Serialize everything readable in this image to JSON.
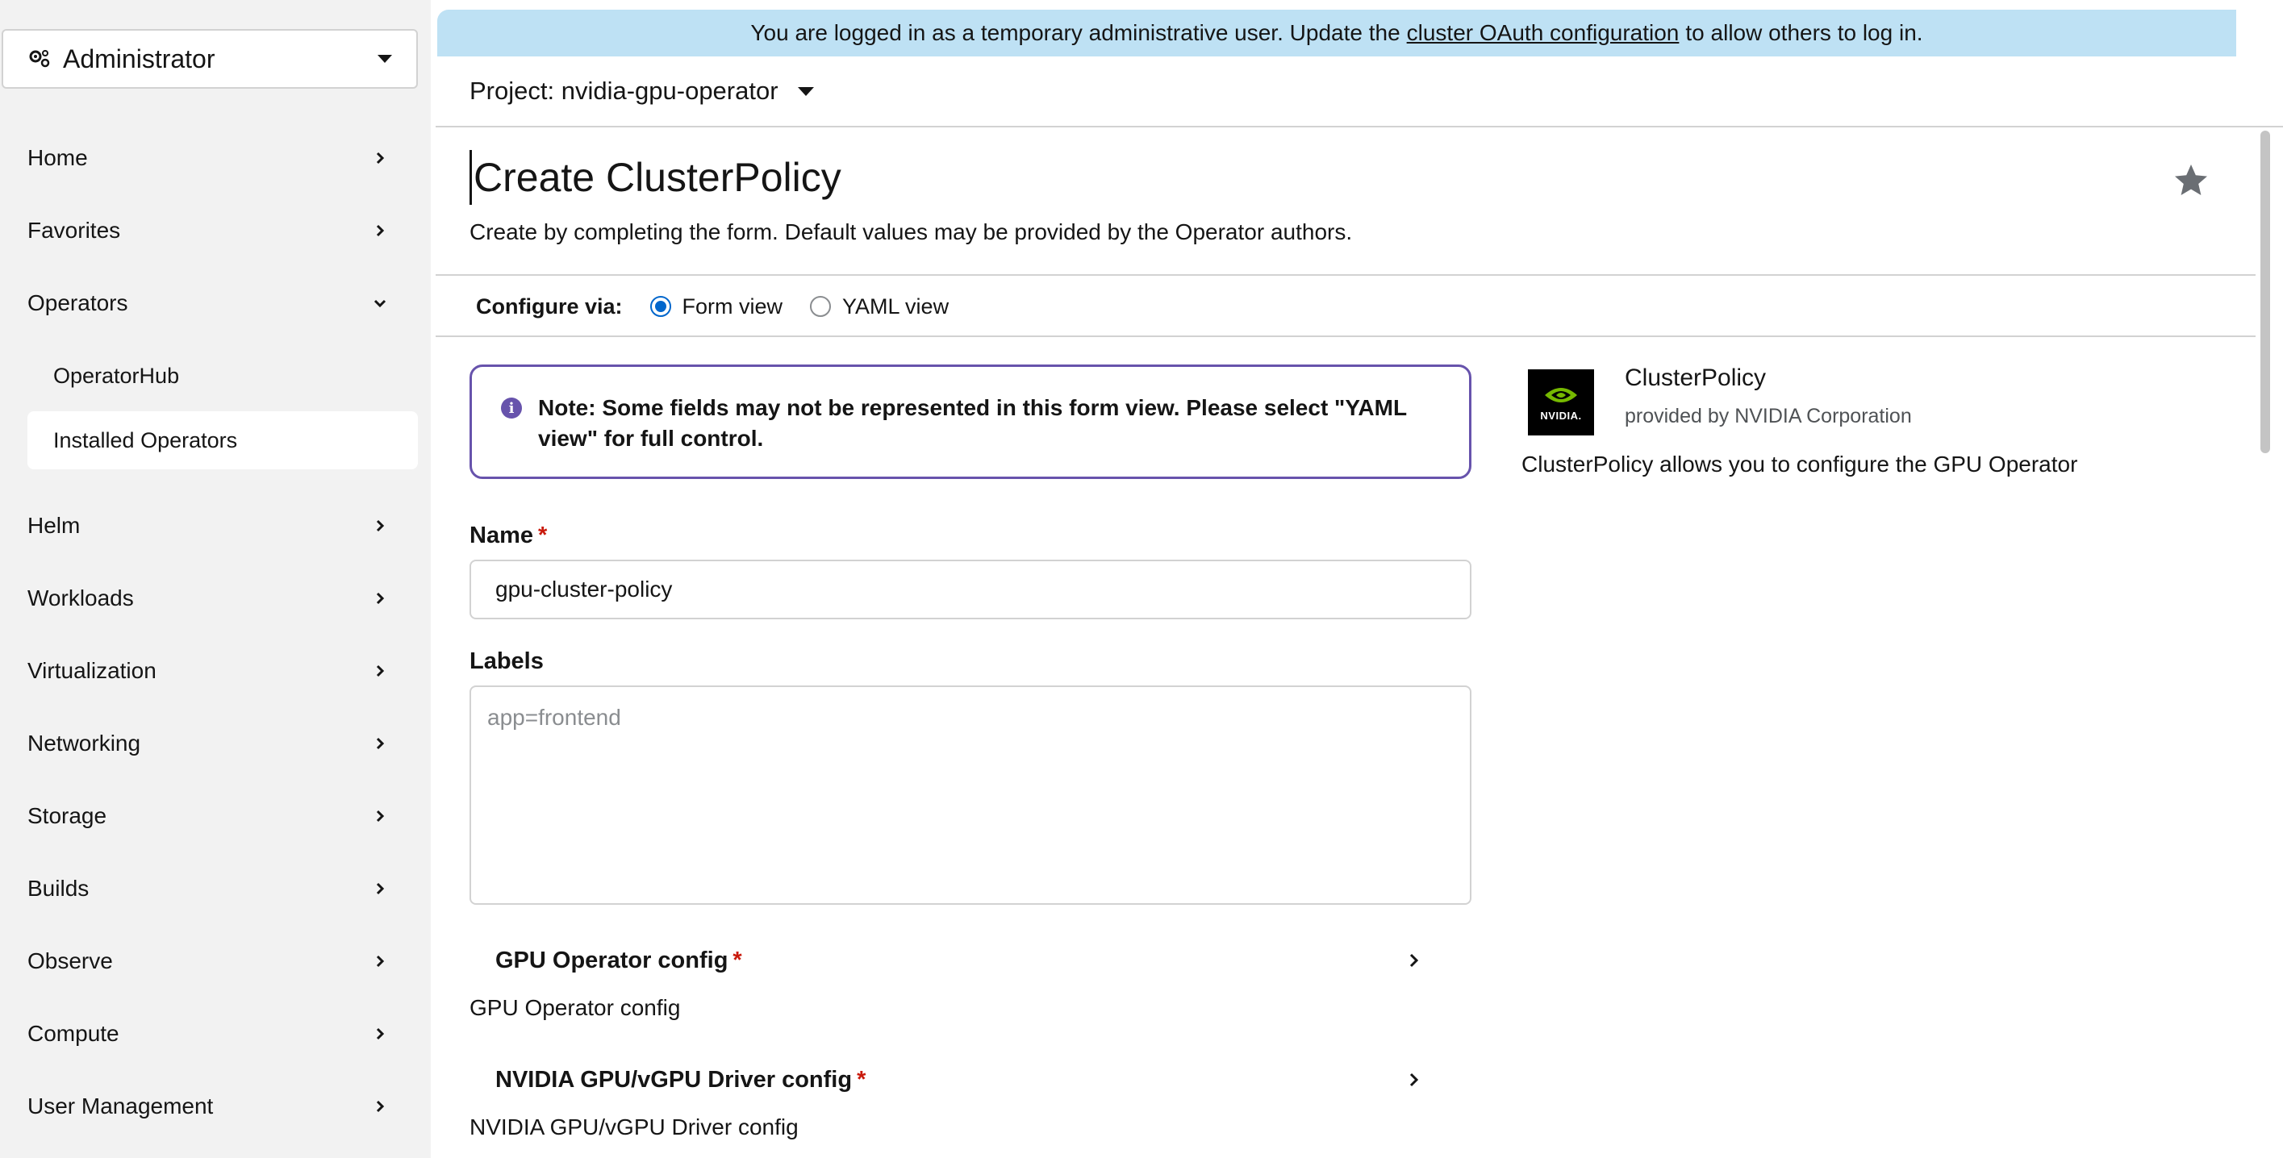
{
  "sidebar": {
    "perspective": "Administrator",
    "items": [
      {
        "label": "Home"
      },
      {
        "label": "Favorites"
      },
      {
        "label": "Operators"
      },
      {
        "label": "Helm"
      },
      {
        "label": "Workloads"
      },
      {
        "label": "Virtualization"
      },
      {
        "label": "Networking"
      },
      {
        "label": "Storage"
      },
      {
        "label": "Builds"
      },
      {
        "label": "Observe"
      },
      {
        "label": "Compute"
      },
      {
        "label": "User Management"
      }
    ],
    "operators_sub": [
      {
        "label": "OperatorHub"
      },
      {
        "label": "Installed Operators"
      }
    ]
  },
  "banner": {
    "prefix": "You are logged in as a temporary administrative user. Update the",
    "link": "cluster OAuth configuration",
    "suffix": "to allow others to log in."
  },
  "project": {
    "label": "Project: nvidia-gpu-operator"
  },
  "page": {
    "title": "Create ClusterPolicy",
    "description": "Create by completing the form. Default values may be provided by the Operator authors."
  },
  "configure": {
    "label": "Configure via:",
    "form_view": "Form view",
    "yaml_view": "YAML view",
    "selected": "Form view"
  },
  "note": {
    "text": "Note: Some fields may not be represented in this form view. Please select \"YAML view\" for full control."
  },
  "form": {
    "name_label": "Name",
    "required_mark": "*",
    "name_value": "gpu-cluster-policy",
    "labels_label": "Labels",
    "labels_placeholder": "app=frontend",
    "sections": [
      {
        "title": "GPU Operator config",
        "helper": "GPU Operator config"
      },
      {
        "title": "NVIDIA GPU/vGPU Driver config",
        "helper": "NVIDIA GPU/vGPU Driver config"
      }
    ]
  },
  "operator_card": {
    "logo_text": "NVIDIA.",
    "name": "ClusterPolicy",
    "provider": "provided by NVIDIA Corporation",
    "description": "ClusterPolicy allows you to configure the GPU Operator"
  },
  "colors": {
    "banner_bg": "#bee1f4",
    "note_border": "#6753ac",
    "radio_checked": "#0066cc",
    "required": "#c9190b",
    "sidebar_bg": "#f2f2f2"
  }
}
